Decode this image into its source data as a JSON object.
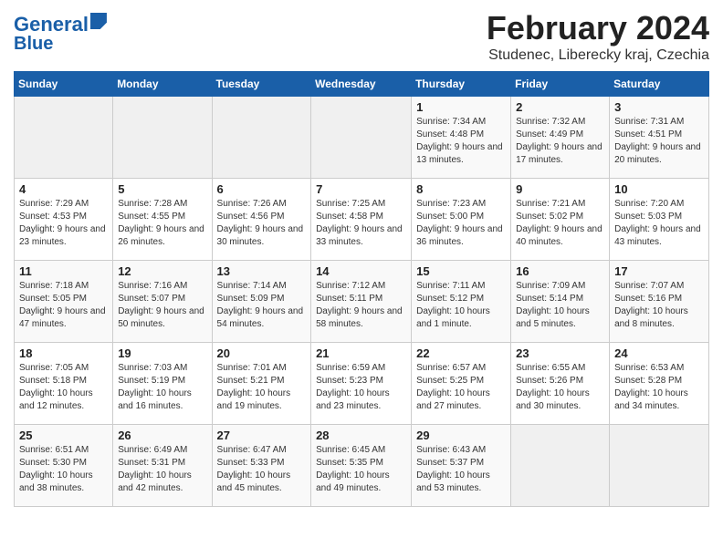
{
  "app": {
    "logo_line1": "General",
    "logo_line2": "Blue"
  },
  "header": {
    "month": "February 2024",
    "location": "Studenec, Liberecky kraj, Czechia"
  },
  "weekdays": [
    "Sunday",
    "Monday",
    "Tuesday",
    "Wednesday",
    "Thursday",
    "Friday",
    "Saturday"
  ],
  "weeks": [
    [
      {
        "day": "",
        "info": ""
      },
      {
        "day": "",
        "info": ""
      },
      {
        "day": "",
        "info": ""
      },
      {
        "day": "",
        "info": ""
      },
      {
        "day": "1",
        "info": "Sunrise: 7:34 AM\nSunset: 4:48 PM\nDaylight: 9 hours\nand 13 minutes."
      },
      {
        "day": "2",
        "info": "Sunrise: 7:32 AM\nSunset: 4:49 PM\nDaylight: 9 hours\nand 17 minutes."
      },
      {
        "day": "3",
        "info": "Sunrise: 7:31 AM\nSunset: 4:51 PM\nDaylight: 9 hours\nand 20 minutes."
      }
    ],
    [
      {
        "day": "4",
        "info": "Sunrise: 7:29 AM\nSunset: 4:53 PM\nDaylight: 9 hours\nand 23 minutes."
      },
      {
        "day": "5",
        "info": "Sunrise: 7:28 AM\nSunset: 4:55 PM\nDaylight: 9 hours\nand 26 minutes."
      },
      {
        "day": "6",
        "info": "Sunrise: 7:26 AM\nSunset: 4:56 PM\nDaylight: 9 hours\nand 30 minutes."
      },
      {
        "day": "7",
        "info": "Sunrise: 7:25 AM\nSunset: 4:58 PM\nDaylight: 9 hours\nand 33 minutes."
      },
      {
        "day": "8",
        "info": "Sunrise: 7:23 AM\nSunset: 5:00 PM\nDaylight: 9 hours\nand 36 minutes."
      },
      {
        "day": "9",
        "info": "Sunrise: 7:21 AM\nSunset: 5:02 PM\nDaylight: 9 hours\nand 40 minutes."
      },
      {
        "day": "10",
        "info": "Sunrise: 7:20 AM\nSunset: 5:03 PM\nDaylight: 9 hours\nand 43 minutes."
      }
    ],
    [
      {
        "day": "11",
        "info": "Sunrise: 7:18 AM\nSunset: 5:05 PM\nDaylight: 9 hours\nand 47 minutes."
      },
      {
        "day": "12",
        "info": "Sunrise: 7:16 AM\nSunset: 5:07 PM\nDaylight: 9 hours\nand 50 minutes."
      },
      {
        "day": "13",
        "info": "Sunrise: 7:14 AM\nSunset: 5:09 PM\nDaylight: 9 hours\nand 54 minutes."
      },
      {
        "day": "14",
        "info": "Sunrise: 7:12 AM\nSunset: 5:11 PM\nDaylight: 9 hours\nand 58 minutes."
      },
      {
        "day": "15",
        "info": "Sunrise: 7:11 AM\nSunset: 5:12 PM\nDaylight: 10 hours\nand 1 minute."
      },
      {
        "day": "16",
        "info": "Sunrise: 7:09 AM\nSunset: 5:14 PM\nDaylight: 10 hours\nand 5 minutes."
      },
      {
        "day": "17",
        "info": "Sunrise: 7:07 AM\nSunset: 5:16 PM\nDaylight: 10 hours\nand 8 minutes."
      }
    ],
    [
      {
        "day": "18",
        "info": "Sunrise: 7:05 AM\nSunset: 5:18 PM\nDaylight: 10 hours\nand 12 minutes."
      },
      {
        "day": "19",
        "info": "Sunrise: 7:03 AM\nSunset: 5:19 PM\nDaylight: 10 hours\nand 16 minutes."
      },
      {
        "day": "20",
        "info": "Sunrise: 7:01 AM\nSunset: 5:21 PM\nDaylight: 10 hours\nand 19 minutes."
      },
      {
        "day": "21",
        "info": "Sunrise: 6:59 AM\nSunset: 5:23 PM\nDaylight: 10 hours\nand 23 minutes."
      },
      {
        "day": "22",
        "info": "Sunrise: 6:57 AM\nSunset: 5:25 PM\nDaylight: 10 hours\nand 27 minutes."
      },
      {
        "day": "23",
        "info": "Sunrise: 6:55 AM\nSunset: 5:26 PM\nDaylight: 10 hours\nand 30 minutes."
      },
      {
        "day": "24",
        "info": "Sunrise: 6:53 AM\nSunset: 5:28 PM\nDaylight: 10 hours\nand 34 minutes."
      }
    ],
    [
      {
        "day": "25",
        "info": "Sunrise: 6:51 AM\nSunset: 5:30 PM\nDaylight: 10 hours\nand 38 minutes."
      },
      {
        "day": "26",
        "info": "Sunrise: 6:49 AM\nSunset: 5:31 PM\nDaylight: 10 hours\nand 42 minutes."
      },
      {
        "day": "27",
        "info": "Sunrise: 6:47 AM\nSunset: 5:33 PM\nDaylight: 10 hours\nand 45 minutes."
      },
      {
        "day": "28",
        "info": "Sunrise: 6:45 AM\nSunset: 5:35 PM\nDaylight: 10 hours\nand 49 minutes."
      },
      {
        "day": "29",
        "info": "Sunrise: 6:43 AM\nSunset: 5:37 PM\nDaylight: 10 hours\nand 53 minutes."
      },
      {
        "day": "",
        "info": ""
      },
      {
        "day": "",
        "info": ""
      }
    ]
  ]
}
